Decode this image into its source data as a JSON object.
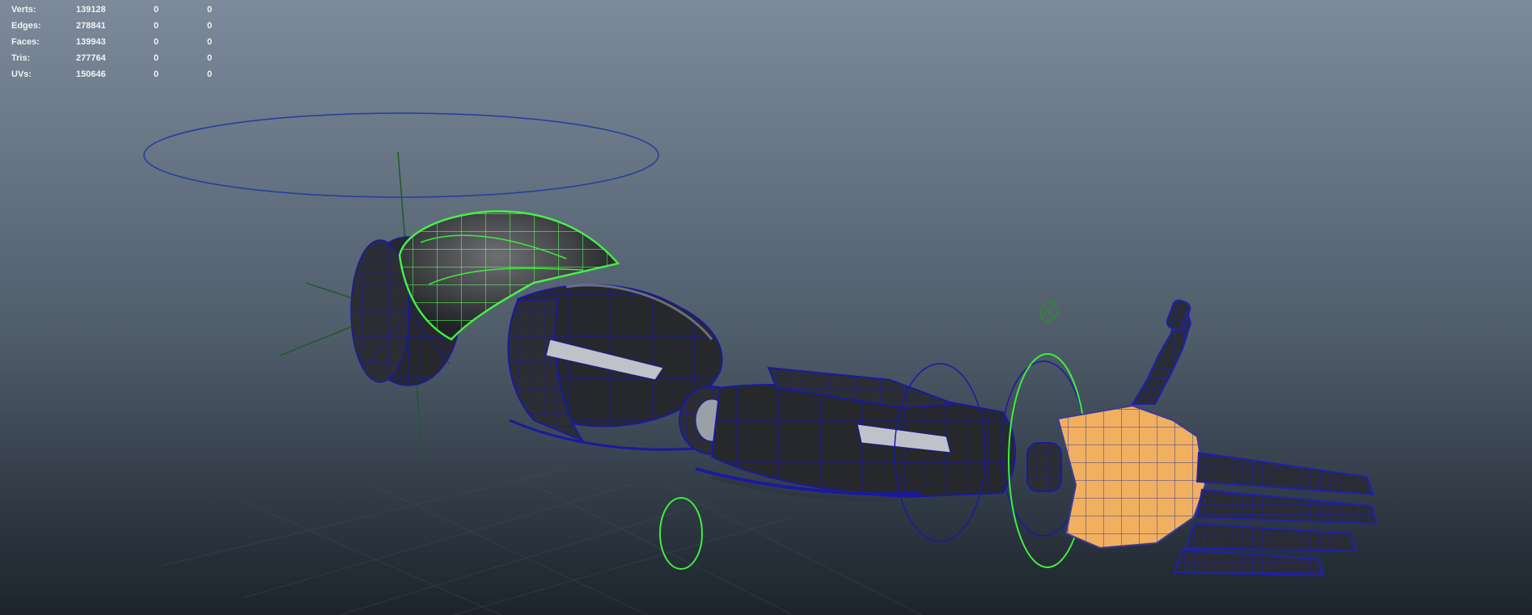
{
  "viewport": {
    "title": "",
    "background_top": "#7c8a9b",
    "background_bottom": "#1c232b"
  },
  "hud": {
    "rows": [
      {
        "label": "Verts:",
        "values": [
          "139128",
          "0",
          "0"
        ]
      },
      {
        "label": "Edges:",
        "values": [
          "278841",
          "0",
          "0"
        ]
      },
      {
        "label": "Faces:",
        "values": [
          "139943",
          "0",
          "0"
        ]
      },
      {
        "label": "Tris:",
        "values": [
          "277764",
          "0",
          "0"
        ]
      },
      {
        "label": "UVs:",
        "values": [
          "150646",
          "0",
          "0"
        ]
      }
    ]
  },
  "colors": {
    "wire_blue": "#1a1aa0",
    "control_curve": "#243c9c",
    "selected_green": "#3cf03c",
    "mesh_dark": "#26282c",
    "hand_orange": "#f0b060",
    "joint_green": "#1f5a28"
  },
  "model": {
    "name": "robotic-arm",
    "parts": [
      "shoulder-disc",
      "shoulder-plate",
      "upper-arm",
      "elbow",
      "forearm",
      "wrist",
      "hand",
      "fingers",
      "thumb"
    ]
  }
}
